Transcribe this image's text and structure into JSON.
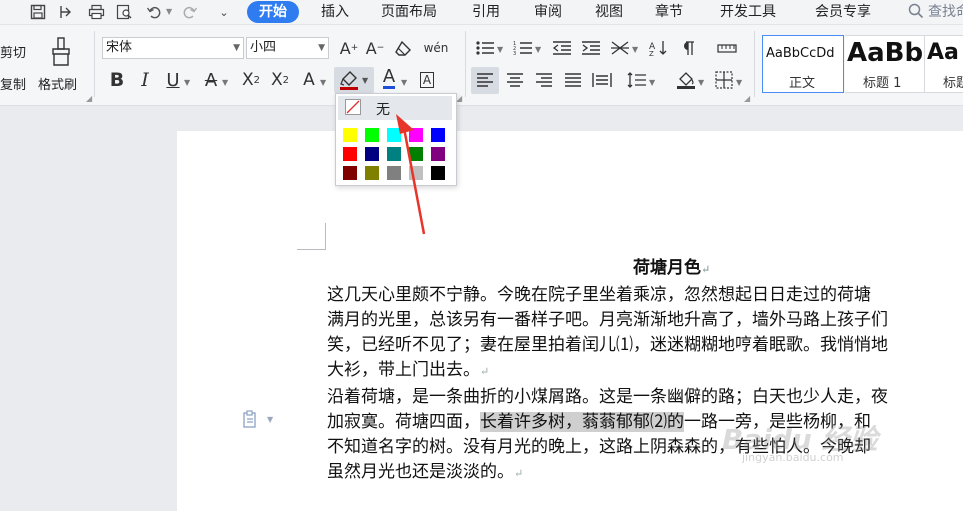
{
  "menu": {
    "tabs": [
      "开始",
      "插入",
      "页面布局",
      "引用",
      "审阅",
      "视图",
      "章节",
      "开发工具",
      "会员专享"
    ],
    "search_text": "查找命"
  },
  "ribbon": {
    "cut_label": "剪切",
    "copy_label": "复制",
    "format_painter_label": "格式刷",
    "font_name": "宋体",
    "font_size": "小四",
    "phonetic_glyph": "wén",
    "styles": [
      {
        "preview": "AaBbCcDd",
        "label": "正文"
      },
      {
        "preview": "AaBb",
        "label": "标题 1"
      },
      {
        "preview": "Aa",
        "label": "标题"
      }
    ]
  },
  "highlight_dropdown": {
    "none_label": "无",
    "colors": [
      [
        "#ffff00",
        "#00ff00",
        "#00ffff",
        "#ff00ff",
        "#0000ff"
      ],
      [
        "#ff0000",
        "#000080",
        "#008080",
        "#008000",
        "#800080"
      ],
      [
        "#800000",
        "#808000",
        "#808080",
        "#c0c0c0",
        "#000000"
      ]
    ]
  },
  "document": {
    "title": "荷塘月色",
    "lines": [
      "这几天心里颇不宁静。今晚在院子里坐着乘凉，忽然想起日日走过的荷塘",
      "满月的光里，总该另有一番样子吧。月亮渐渐地升高了，墙外马路上孩子们",
      "笑，已经听不见了；妻在屋里拍着闰儿⑴，迷迷糊糊地哼着眠歌。我悄悄地",
      "大衫，带上门出去。",
      "沿着荷塘，是一条曲折的小煤屑路。这是一条幽僻的路；白天也少人走，夜",
      "加寂寞。荷塘四面，",
      "长着许多树，蓊蓊郁郁⑵的",
      "一路一旁，是些杨柳，和",
      "不知道名字的树。没有月光的晚上，这路上阴森森的，有些怕人。今晚却",
      "虽然月光也还是淡淡的。"
    ]
  },
  "watermark": "Baidu 经验",
  "watermark_url": "jingyan.baidu.com",
  "colors": {
    "accent": "#2f7bf0",
    "arrow": "#e8352a",
    "highlight_gray": "#cfcfcf"
  }
}
